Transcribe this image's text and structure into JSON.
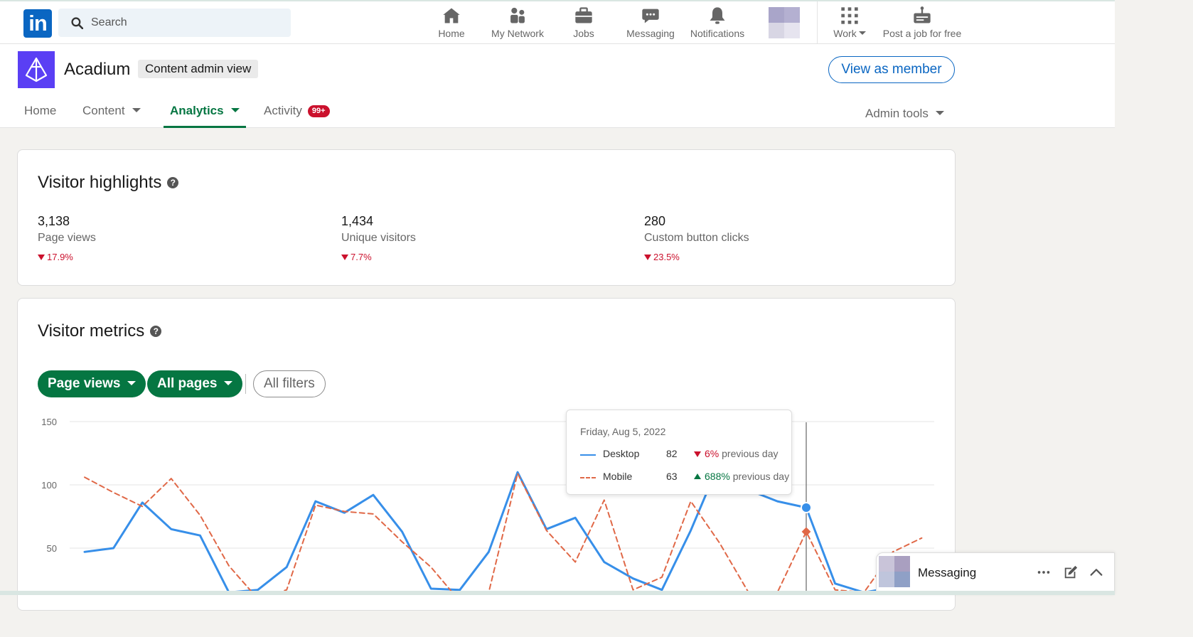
{
  "nav": {
    "logo_text": "in",
    "search_placeholder": "Search",
    "items": [
      {
        "label": "Home",
        "icon": "home-icon"
      },
      {
        "label": "My Network",
        "icon": "network-icon"
      },
      {
        "label": "Jobs",
        "icon": "briefcase-icon"
      },
      {
        "label": "Messaging",
        "icon": "chat-icon"
      },
      {
        "label": "Notifications",
        "icon": "bell-icon"
      },
      {
        "label": "Work",
        "icon": "grid-icon"
      },
      {
        "label": "Post a job for free",
        "icon": "post-job-icon"
      }
    ]
  },
  "org": {
    "name": "Acadium",
    "admin_badge": "Content admin view",
    "view_as_member": "View as member",
    "tabs": [
      {
        "label": "Home"
      },
      {
        "label": "Content"
      },
      {
        "label": "Analytics"
      },
      {
        "label": "Activity"
      }
    ],
    "activity_badge": "99+",
    "admin_tools": "Admin tools",
    "brand_color": "#5a3ff4"
  },
  "highlights": {
    "title": "Visitor highlights",
    "metrics": [
      {
        "value": "3,138",
        "label": "Page views",
        "delta": "17.9%"
      },
      {
        "value": "1,434",
        "label": "Unique visitors",
        "delta": "7.7%"
      },
      {
        "value": "280",
        "label": "Custom button clicks",
        "delta": "23.5%"
      }
    ]
  },
  "visitor_metrics": {
    "title": "Visitor metrics",
    "filters": {
      "metric": "Page views",
      "pages": "All pages",
      "all_filters": "All filters"
    }
  },
  "chart_data": {
    "type": "line",
    "ylim": [
      0,
      150
    ],
    "yticks": [
      "150",
      "100",
      "50"
    ],
    "grid": true,
    "series": [
      {
        "name": "Desktop",
        "color": "#378fe9",
        "style": "solid",
        "values": [
          47,
          50,
          86,
          65,
          60,
          15,
          17,
          35,
          87,
          78,
          92,
          63,
          18,
          17,
          47,
          110,
          65,
          74,
          39,
          26,
          17,
          64,
          118,
          96,
          87,
          82,
          22,
          15,
          19,
          38
        ]
      },
      {
        "name": "Mobile",
        "color": "#e06847",
        "style": "dashed",
        "values": [
          106,
          94,
          83,
          105,
          76,
          36,
          10,
          17,
          84,
          79,
          77,
          55,
          35,
          8,
          15,
          109,
          64,
          39,
          88,
          17,
          27,
          87,
          54,
          15,
          15,
          63,
          17,
          15,
          47,
          58
        ]
      }
    ],
    "highlight_index": 25
  },
  "tooltip": {
    "date": "Friday, Aug 5, 2022",
    "rows": [
      {
        "name": "Desktop",
        "value": "82",
        "direction": "down",
        "change": "6%",
        "suffix": "previous day"
      },
      {
        "name": "Mobile",
        "value": "63",
        "direction": "up",
        "change": "688%",
        "suffix": "previous day"
      }
    ]
  },
  "messaging": {
    "title": "Messaging"
  }
}
